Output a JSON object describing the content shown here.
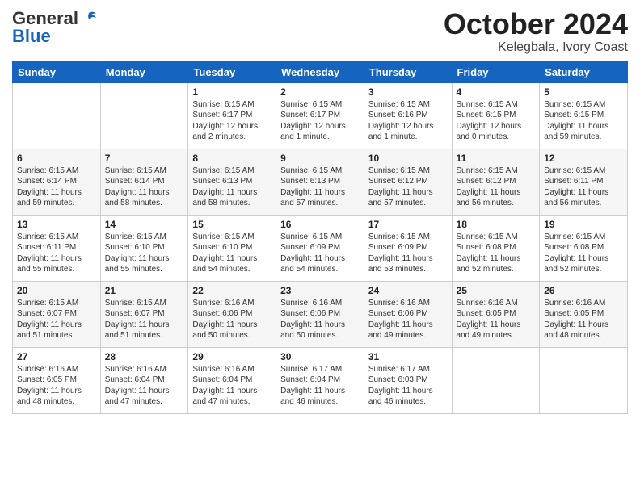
{
  "logo": {
    "general": "General",
    "blue": "Blue",
    "tagline": ""
  },
  "header": {
    "month": "October 2024",
    "location": "Kelegbala, Ivory Coast"
  },
  "weekdays": [
    "Sunday",
    "Monday",
    "Tuesday",
    "Wednesday",
    "Thursday",
    "Friday",
    "Saturday"
  ],
  "weeks": [
    [
      {
        "day": "",
        "info": ""
      },
      {
        "day": "",
        "info": ""
      },
      {
        "day": "1",
        "info": "Sunrise: 6:15 AM\nSunset: 6:17 PM\nDaylight: 12 hours\nand 2 minutes."
      },
      {
        "day": "2",
        "info": "Sunrise: 6:15 AM\nSunset: 6:17 PM\nDaylight: 12 hours\nand 1 minute."
      },
      {
        "day": "3",
        "info": "Sunrise: 6:15 AM\nSunset: 6:16 PM\nDaylight: 12 hours\nand 1 minute."
      },
      {
        "day": "4",
        "info": "Sunrise: 6:15 AM\nSunset: 6:15 PM\nDaylight: 12 hours\nand 0 minutes."
      },
      {
        "day": "5",
        "info": "Sunrise: 6:15 AM\nSunset: 6:15 PM\nDaylight: 11 hours\nand 59 minutes."
      }
    ],
    [
      {
        "day": "6",
        "info": "Sunrise: 6:15 AM\nSunset: 6:14 PM\nDaylight: 11 hours\nand 59 minutes."
      },
      {
        "day": "7",
        "info": "Sunrise: 6:15 AM\nSunset: 6:14 PM\nDaylight: 11 hours\nand 58 minutes."
      },
      {
        "day": "8",
        "info": "Sunrise: 6:15 AM\nSunset: 6:13 PM\nDaylight: 11 hours\nand 58 minutes."
      },
      {
        "day": "9",
        "info": "Sunrise: 6:15 AM\nSunset: 6:13 PM\nDaylight: 11 hours\nand 57 minutes."
      },
      {
        "day": "10",
        "info": "Sunrise: 6:15 AM\nSunset: 6:12 PM\nDaylight: 11 hours\nand 57 minutes."
      },
      {
        "day": "11",
        "info": "Sunrise: 6:15 AM\nSunset: 6:12 PM\nDaylight: 11 hours\nand 56 minutes."
      },
      {
        "day": "12",
        "info": "Sunrise: 6:15 AM\nSunset: 6:11 PM\nDaylight: 11 hours\nand 56 minutes."
      }
    ],
    [
      {
        "day": "13",
        "info": "Sunrise: 6:15 AM\nSunset: 6:11 PM\nDaylight: 11 hours\nand 55 minutes."
      },
      {
        "day": "14",
        "info": "Sunrise: 6:15 AM\nSunset: 6:10 PM\nDaylight: 11 hours\nand 55 minutes."
      },
      {
        "day": "15",
        "info": "Sunrise: 6:15 AM\nSunset: 6:10 PM\nDaylight: 11 hours\nand 54 minutes."
      },
      {
        "day": "16",
        "info": "Sunrise: 6:15 AM\nSunset: 6:09 PM\nDaylight: 11 hours\nand 54 minutes."
      },
      {
        "day": "17",
        "info": "Sunrise: 6:15 AM\nSunset: 6:09 PM\nDaylight: 11 hours\nand 53 minutes."
      },
      {
        "day": "18",
        "info": "Sunrise: 6:15 AM\nSunset: 6:08 PM\nDaylight: 11 hours\nand 52 minutes."
      },
      {
        "day": "19",
        "info": "Sunrise: 6:15 AM\nSunset: 6:08 PM\nDaylight: 11 hours\nand 52 minutes."
      }
    ],
    [
      {
        "day": "20",
        "info": "Sunrise: 6:15 AM\nSunset: 6:07 PM\nDaylight: 11 hours\nand 51 minutes."
      },
      {
        "day": "21",
        "info": "Sunrise: 6:15 AM\nSunset: 6:07 PM\nDaylight: 11 hours\nand 51 minutes."
      },
      {
        "day": "22",
        "info": "Sunrise: 6:16 AM\nSunset: 6:06 PM\nDaylight: 11 hours\nand 50 minutes."
      },
      {
        "day": "23",
        "info": "Sunrise: 6:16 AM\nSunset: 6:06 PM\nDaylight: 11 hours\nand 50 minutes."
      },
      {
        "day": "24",
        "info": "Sunrise: 6:16 AM\nSunset: 6:06 PM\nDaylight: 11 hours\nand 49 minutes."
      },
      {
        "day": "25",
        "info": "Sunrise: 6:16 AM\nSunset: 6:05 PM\nDaylight: 11 hours\nand 49 minutes."
      },
      {
        "day": "26",
        "info": "Sunrise: 6:16 AM\nSunset: 6:05 PM\nDaylight: 11 hours\nand 48 minutes."
      }
    ],
    [
      {
        "day": "27",
        "info": "Sunrise: 6:16 AM\nSunset: 6:05 PM\nDaylight: 11 hours\nand 48 minutes."
      },
      {
        "day": "28",
        "info": "Sunrise: 6:16 AM\nSunset: 6:04 PM\nDaylight: 11 hours\nand 47 minutes."
      },
      {
        "day": "29",
        "info": "Sunrise: 6:16 AM\nSunset: 6:04 PM\nDaylight: 11 hours\nand 47 minutes."
      },
      {
        "day": "30",
        "info": "Sunrise: 6:17 AM\nSunset: 6:04 PM\nDaylight: 11 hours\nand 46 minutes."
      },
      {
        "day": "31",
        "info": "Sunrise: 6:17 AM\nSunset: 6:03 PM\nDaylight: 11 hours\nand 46 minutes."
      },
      {
        "day": "",
        "info": ""
      },
      {
        "day": "",
        "info": ""
      }
    ]
  ]
}
